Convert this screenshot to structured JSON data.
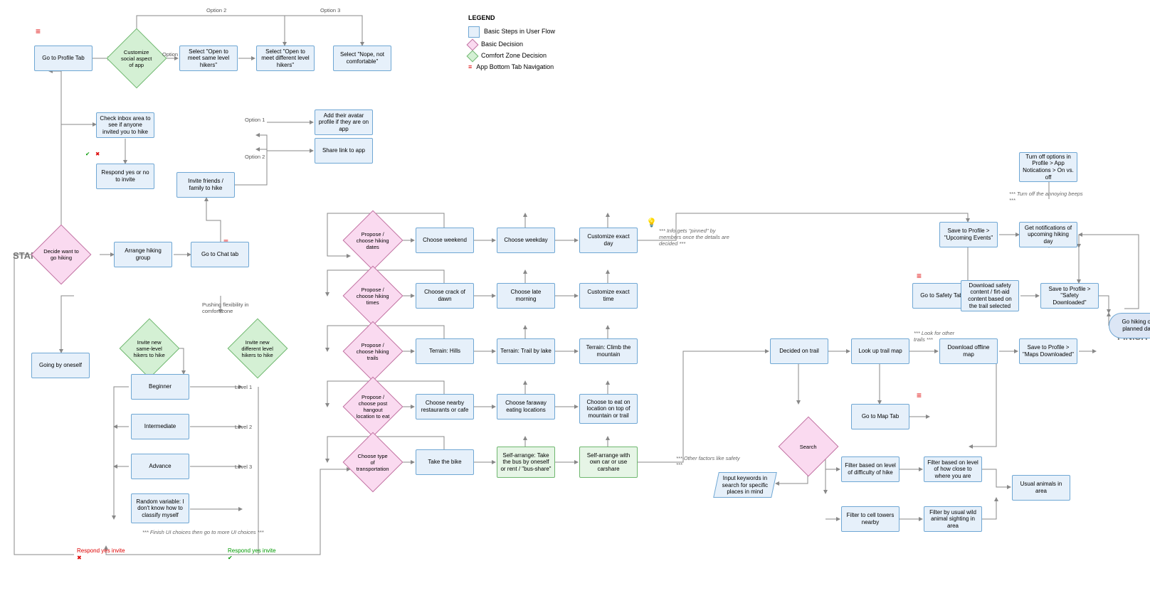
{
  "labels": {
    "start": "START",
    "finish": "FINISH",
    "legend_title": "LEGEND",
    "leg1": "Basic Steps in User Flow",
    "leg2": "Basic Decision",
    "leg3": "Comfort Zone Decision",
    "leg4": "App Bottom Tab Navigation",
    "opt1": "Option 1",
    "opt2": "Option 2",
    "opt3": "Option 3",
    "lv1": "Level 1",
    "lv2": "Level 2",
    "lv3": "Level 3",
    "push": "Pushing flexibility in comfort zone",
    "finish_ui": "*** Finish UI choices then go to more UI choices ***",
    "resp_no": "Respond yes invite",
    "resp_yes": "Respond yes invite",
    "pinned": "*** Info gets \"pinned\" by members once the details are decided ***",
    "safety": "*** Other factors like safety ***",
    "look": "*** Look for other trails ***",
    "beeps": "*** Turn off the annoying beeps ***"
  },
  "nodes": {
    "n1": "Go to Profile Tab",
    "n2": "Customize social aspect of app",
    "n3": "Select \"Open to meet same level hikers\"",
    "n4": "Select \"Open to meet different level hikers\"",
    "n5": "Select \"Nope, not comfortable\"",
    "n6": "Check inbox area to see if anyone invited you to hike",
    "n7": "Respond yes or no to invite",
    "n8": "Invite friends / family to hike",
    "n9": "Add their avatar profile if they are on app",
    "n10": "Share link to app",
    "n11": "Decide want to go hiking",
    "n12": "Arrange hiking group",
    "n13": "Go to Chat tab",
    "n14": "Going by oneself",
    "n15": "Invite new same-level hikers to hike",
    "n16": "Invite new different level hikers to hike",
    "n17": "Beginner",
    "n18": "Intermediate",
    "n19": "Advance",
    "n20": "Random variable: I don't know how to classify myself",
    "n21": "Propose / choose hiking dates",
    "n22": "Choose weekend",
    "n23": "Choose weekday",
    "n24": "Customize exact day",
    "n25": "Propose / choose hiking times",
    "n26": "Choose crack of dawn",
    "n27": "Choose late morning",
    "n28": "Customize exact time",
    "n29": "Propose / choose hiking trails",
    "n30": "Terrain: Hills",
    "n31": "Terrain: Trail by lake",
    "n32": "Terrain: Climb the mountain",
    "n33": "Propose / choose post hangout location to eat",
    "n34": "Choose nearby restaurants or cafe",
    "n35": "Choose faraway eating locations",
    "n36": "Choose to eat on location on top of mountain or trail",
    "n37": "Choose type of transportation",
    "n38": "Take the bike",
    "n39": "Self-arrange: Take the bus by oneself or rent / \"bus-share\"",
    "n40": "Self-arrange with own car or use carshare",
    "n41": "Decided on trail",
    "n42": "Look up trail map",
    "n43": "Download offline map",
    "n44": "Save to Profile > \"Maps Downloaded\"",
    "n45": "Go to Safety Tab",
    "n46": "Download safety content / firt-aid content based on the trail selected",
    "n47": "Save to Profile > \"Safety Downloaded\"",
    "n48": "Save to Profile > \"Upcoming Events\"",
    "n49": "Get notifications of upcoming hiking day",
    "n50": "Turn off options in Profile > App Notications > On vs. off",
    "n51": "Go hiking on planned day",
    "n52": "Go to Map Tab",
    "n53": "Search",
    "n54": "Input keywords in search for specific places in mind",
    "n55": "Filter based on level of difficulty of hike",
    "n56": "Filter based on level of how close to where you are",
    "n57": "Filter to cell towers nearby",
    "n58": "Filter by usual wild animal sighting in area",
    "n59": "Usual animals in area"
  }
}
